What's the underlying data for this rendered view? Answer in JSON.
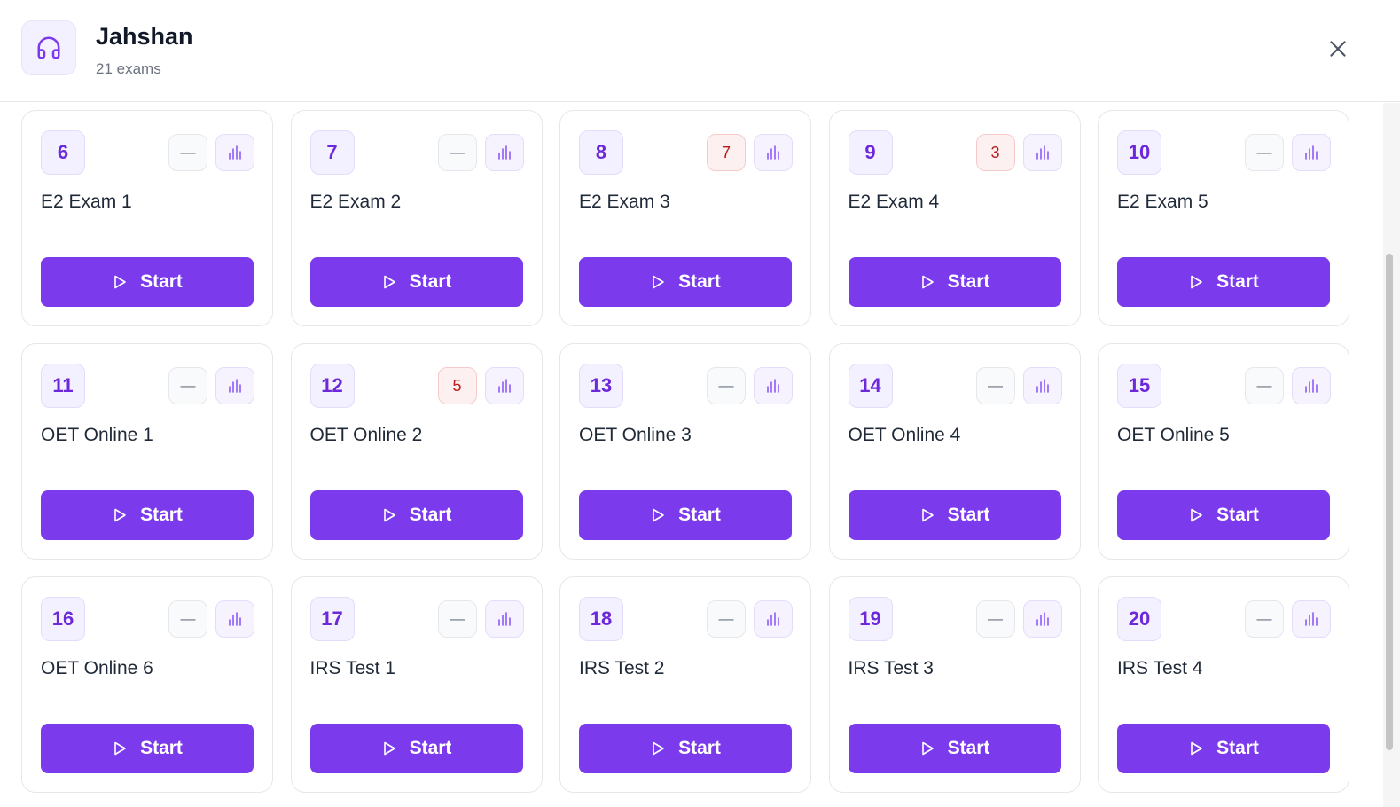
{
  "header": {
    "title": "Jahshan",
    "subtitle": "21 exams",
    "icon": "headphones-icon",
    "close_icon": "close-icon"
  },
  "colors": {
    "accent": "#7c3aed",
    "badge_bg": "#f3f0ff",
    "score_hit_bg": "#fdf0f0",
    "score_hit_text": "#b91c1c"
  },
  "start_label": "Start",
  "exams": [
    {
      "number": "6",
      "title": "E2 Exam 1",
      "score": "—",
      "has_score": false
    },
    {
      "number": "7",
      "title": "E2 Exam 2",
      "score": "—",
      "has_score": false
    },
    {
      "number": "8",
      "title": "E2 Exam 3",
      "score": "7",
      "has_score": true
    },
    {
      "number": "9",
      "title": "E2 Exam 4",
      "score": "3",
      "has_score": true
    },
    {
      "number": "10",
      "title": "E2 Exam 5",
      "score": "—",
      "has_score": false
    },
    {
      "number": "11",
      "title": "OET Online 1",
      "score": "—",
      "has_score": false
    },
    {
      "number": "12",
      "title": "OET Online 2",
      "score": "5",
      "has_score": true
    },
    {
      "number": "13",
      "title": "OET Online 3",
      "score": "—",
      "has_score": false
    },
    {
      "number": "14",
      "title": "OET Online 4",
      "score": "—",
      "has_score": false
    },
    {
      "number": "15",
      "title": "OET Online 5",
      "score": "—",
      "has_score": false
    },
    {
      "number": "16",
      "title": "OET Online 6",
      "score": "—",
      "has_score": false
    },
    {
      "number": "17",
      "title": "IRS Test 1",
      "score": "—",
      "has_score": false
    },
    {
      "number": "18",
      "title": "IRS Test 2",
      "score": "—",
      "has_score": false
    },
    {
      "number": "19",
      "title": "IRS Test 3",
      "score": "—",
      "has_score": false
    },
    {
      "number": "20",
      "title": "IRS Test 4",
      "score": "—",
      "has_score": false
    }
  ]
}
